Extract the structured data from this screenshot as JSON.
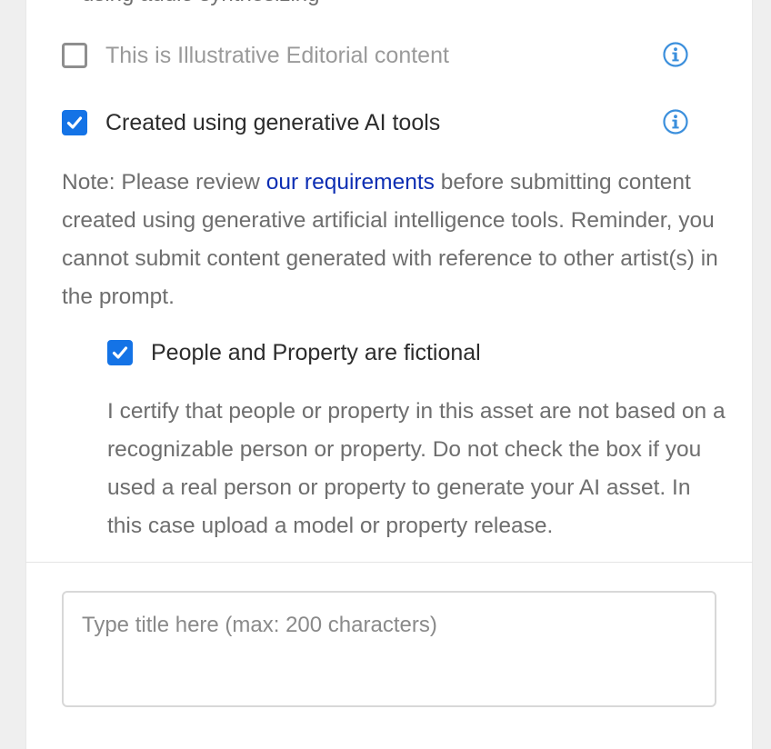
{
  "cutoff_text": "using audio synthesizing",
  "checkboxes": {
    "editorial": {
      "label": "This is Illustrative Editorial content",
      "checked": false,
      "disabled": true
    },
    "generative_ai": {
      "label": "Created using generative AI tools",
      "checked": true
    },
    "fictional": {
      "label": "People and Property are fictional",
      "checked": true
    }
  },
  "note": {
    "prefix": "Note: Please review ",
    "link_text": "our requirements",
    "suffix": " before submitting content created using generative artificial intelligence tools. Reminder, you cannot submit content generated with reference to other artist(s) in the prompt."
  },
  "certification": "I certify that people or property in this asset are not based on a recognizable person or property. Do not check the box if you used a real person or property to generate your AI asset. In this case upload a model or property release.",
  "title_input": {
    "placeholder": "Type title here (max: 200 characters)",
    "value": ""
  },
  "colors": {
    "accent": "#1473e6",
    "link": "#0d2eb3",
    "info_icon": "#3b8fdc"
  },
  "icons": {
    "info": "info-circle-icon",
    "check": "checkmark-icon"
  }
}
